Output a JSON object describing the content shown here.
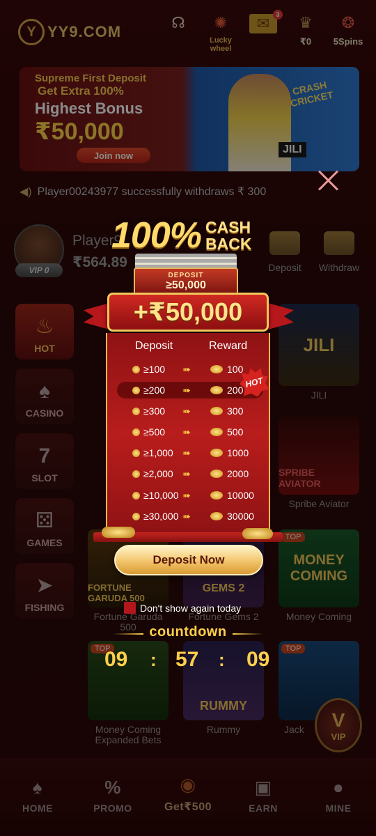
{
  "header": {
    "logo": "YY9.COM",
    "logo_mark": "Y",
    "actions": [
      {
        "label": "",
        "icon": "customer-service-icon"
      },
      {
        "label": "Lucky wheel",
        "icon": "lucky-wheel-icon"
      },
      {
        "label": "",
        "icon": "mail-icon",
        "badge": "3"
      },
      {
        "label": "₹0",
        "icon": "treasure-icon"
      },
      {
        "label": "5Spins",
        "icon": "spin-icon"
      }
    ]
  },
  "banner": {
    "line1": "Supreme First Deposit",
    "line2": "Get Extra 100%",
    "line3": "Highest Bonus",
    "amount": "₹50,000",
    "button": "Join now",
    "brand": "JILI",
    "tag": "CRASH CRICKET"
  },
  "ticker": {
    "text": "Player00243977 successfully withdraws ₹ 300"
  },
  "profile": {
    "name": "Player9",
    "balance": "₹564.89",
    "vip": "VIP 0",
    "deposit": "Deposit",
    "withdraw": "Withdraw"
  },
  "categories": [
    {
      "label": "HOT",
      "icon": "flame-icon"
    },
    {
      "label": "CASINO",
      "icon": "cards-icon"
    },
    {
      "label": "SLOT",
      "icon": "slot-machine-icon"
    },
    {
      "label": "GAMES",
      "icon": "dice-icon"
    },
    {
      "label": "FISHING",
      "icon": "fish-icon"
    }
  ],
  "games": [
    {
      "name": "JILI",
      "brand": "JILI"
    },
    {
      "name": "Spribe Aviator",
      "brand": "SPRIBE AVIATOR"
    },
    {
      "name": "Fortune Garuda 500",
      "brand": "FORTUNE GARUDA 500"
    },
    {
      "name": "Fortune Gems 2",
      "brand": "GEMS 2"
    },
    {
      "name": "Money Coming",
      "brand": "MONEY COMING",
      "badge": "TOP"
    },
    {
      "name": "Money Coming Expanded Bets",
      "badge": "TOP"
    },
    {
      "name": "Rummy",
      "brand": "RUMMY"
    },
    {
      "name": "Jack",
      "badge": "TOP"
    }
  ],
  "bottom_nav": [
    {
      "label": "HOME",
      "icon": "spade-icon"
    },
    {
      "label": "PROMO",
      "icon": "promo-icon"
    },
    {
      "label": "Get₹500",
      "icon": "wheel-icon"
    },
    {
      "label": "EARN",
      "icon": "gift-icon"
    },
    {
      "label": "MINE",
      "icon": "user-drop-icon"
    }
  ],
  "float_vip": {
    "label": "VIP",
    "letter": "V"
  },
  "popup": {
    "title_big": "100%",
    "title_small_1": "CASH",
    "title_small_2": "BACK",
    "deposit_label": "DEPOSIT",
    "deposit_threshold": "≥50,000",
    "amount": "+₹50,000",
    "col_deposit": "Deposit",
    "col_reward": "Reward",
    "rows": [
      {
        "deposit": "≥100",
        "reward": "100"
      },
      {
        "deposit": "≥200",
        "reward": "200"
      },
      {
        "deposit": "≥300",
        "reward": "300"
      },
      {
        "deposit": "≥500",
        "reward": "500"
      },
      {
        "deposit": "≥1,000",
        "reward": "1000"
      },
      {
        "deposit": "≥2,000",
        "reward": "2000"
      },
      {
        "deposit": "≥10,000",
        "reward": "10000"
      },
      {
        "deposit": "≥30,000",
        "reward": "30000"
      }
    ],
    "hot_tag": "HOT",
    "button": "Deposit Now",
    "dont_show": "Don't show again today",
    "countdown_label": "countdown",
    "timer": {
      "h": "09",
      "m": "57",
      "s": "09",
      "sep": ":"
    }
  }
}
